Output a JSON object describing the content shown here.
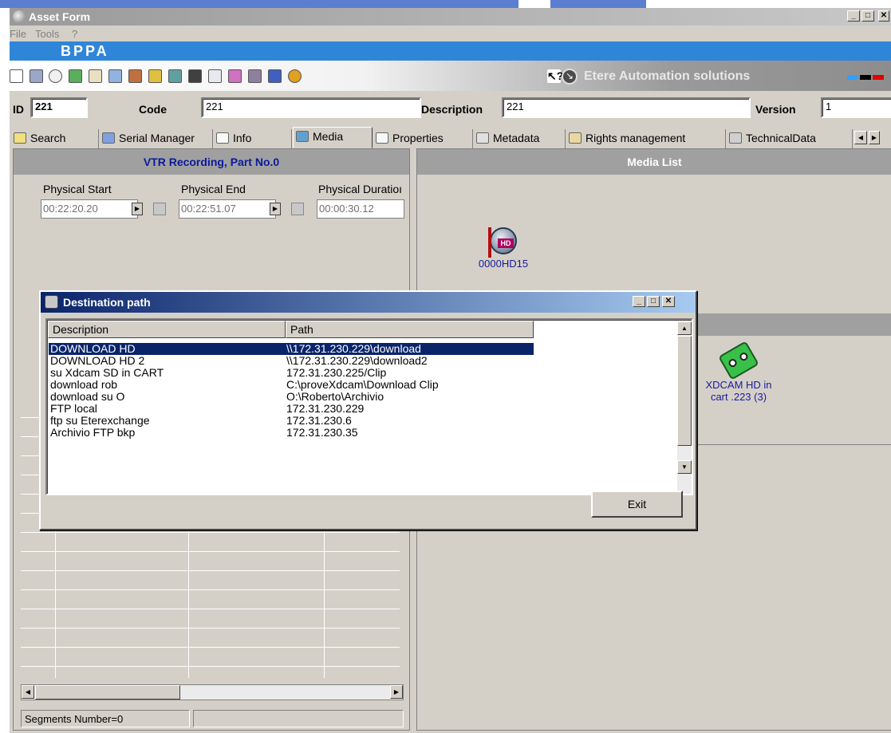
{
  "window": {
    "title": "Asset Form"
  },
  "menu": [
    "File",
    "Tools",
    "?"
  ],
  "brand": "BPPA",
  "toolbar": {
    "vendor": "Etere Automation solutions"
  },
  "fields": {
    "id_label": "ID",
    "id_value": "221",
    "code_label": "Code",
    "code_value": "221",
    "description_label": "Description",
    "description_value": "221",
    "version_label": "Version",
    "version_value": "1"
  },
  "tabs": [
    "Search",
    "Serial Manager",
    "Info",
    "Media",
    "Properties",
    "Metadata",
    "Rights management",
    "TechnicalData"
  ],
  "active_tab": "Media",
  "left_panel": {
    "header": "VTR Recording, Part No.0",
    "physical_start_label": "Physical Start",
    "physical_start": "00:22:20.20",
    "physical_end_label": "Physical End",
    "physical_end": "00:22:51.07",
    "physical_duration_label": "Physical Duratioı",
    "physical_duration": "00:00:30.12",
    "segments": "Segments Number=0"
  },
  "right_panel": {
    "header": "Media List",
    "media_item": "0000HD15",
    "cart_item_line1": "XDCAM HD in",
    "cart_item_line2": "cart .223 (3)"
  },
  "dialog": {
    "title": "Destination path",
    "columns": [
      "Description",
      "Path"
    ],
    "rows": [
      {
        "description": "DOWNLOAD HD",
        "path": "\\\\172.31.230.229\\download"
      },
      {
        "description": "DOWNLOAD HD 2",
        "path": "\\\\172.31.230.229\\download2"
      },
      {
        "description": "su Xdcam SD in CART",
        "path": "172.31.230.225/Clip"
      },
      {
        "description": "download rob",
        "path": "C:\\proveXdcam\\Download Clip"
      },
      {
        "description": "download su O",
        "path": "O:\\Roberto\\Archivio"
      },
      {
        "description": "FTP local",
        "path": "172.31.230.229"
      },
      {
        "description": "ftp su Eterexchange",
        "path": "172.31.230.6"
      },
      {
        "description": "Archivio FTP bkp",
        "path": "172.31.230.35"
      }
    ],
    "selected_row": 0,
    "exit_label": "Exit"
  },
  "colors": {
    "title_active": "#0a246a",
    "brand_bar": "#2f86d8",
    "selection": "#0a246a"
  }
}
